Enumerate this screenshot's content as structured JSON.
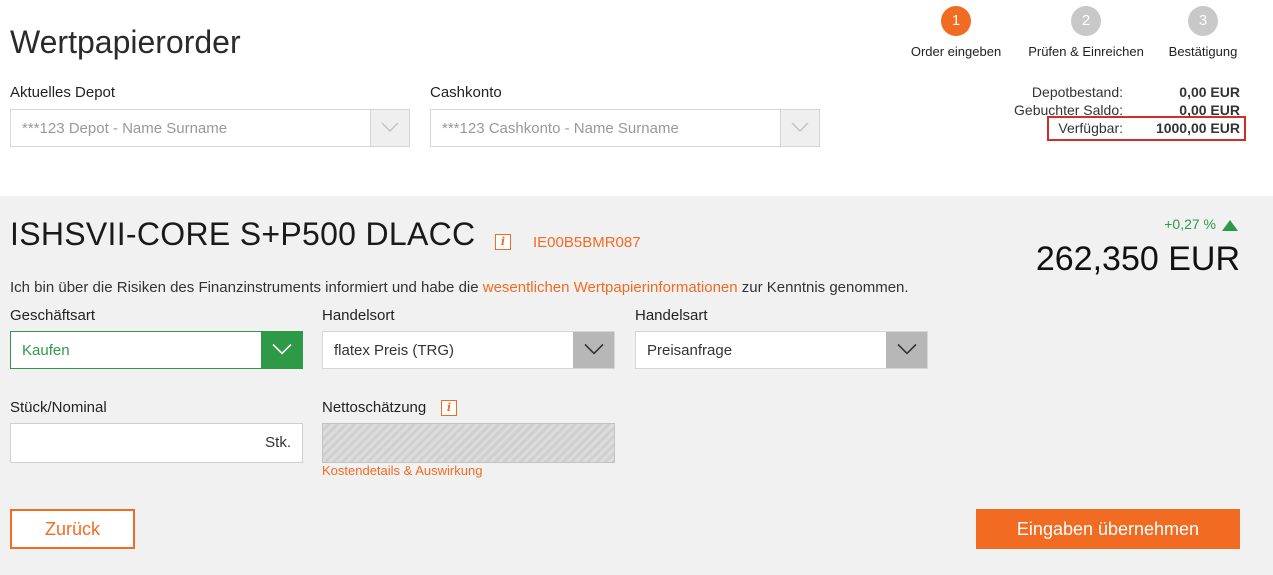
{
  "header": {
    "title": "Wertpapierorder"
  },
  "steps": [
    {
      "number": "1",
      "label": "Order eingeben"
    },
    {
      "number": "2",
      "label": "Prüfen & Einreichen"
    },
    {
      "number": "3",
      "label": "Bestätigung"
    }
  ],
  "depot": {
    "label": "Aktuelles Depot",
    "placeholder": "***123 Depot - Name Surname"
  },
  "cashkonto": {
    "label": "Cashkonto",
    "placeholder": "***123 Cashkonto - Name Surname"
  },
  "balances": [
    {
      "label": "Depotbestand:",
      "value": "0,00 EUR"
    },
    {
      "label": "Gebuchter Saldo:",
      "value": "0,00 EUR"
    },
    {
      "label": "Verfügbar:",
      "value": "1000,00 EUR"
    }
  ],
  "instrument": {
    "name": "ISHSVII-CORE S+P500 DLACC",
    "info_icon": "i",
    "isin": "IE00B5BMR087",
    "change": "+0,27 %",
    "price": "262,350 EUR"
  },
  "disclaimer": {
    "before": "Ich bin über die Risiken des Finanzinstruments informiert und habe die ",
    "link": "wesentlichen Wertpapierinformationen",
    "after": " zur Kenntnis genommen."
  },
  "form": {
    "geschaeftsart": {
      "label": "Geschäftsart",
      "value": "Kaufen"
    },
    "handelsort": {
      "label": "Handelsort",
      "value": "flatex Preis (TRG)"
    },
    "handelsart": {
      "label": "Handelsart",
      "value": "Preisanfrage"
    },
    "stueck": {
      "label": "Stück/Nominal",
      "unit": "Stk."
    },
    "netto": {
      "label": "Nettoschätzung",
      "info_icon": "i",
      "cost_link": "Kostendetails & Auswirkung"
    }
  },
  "buttons": {
    "back": "Zurück",
    "submit": "Eingaben übernehmen"
  },
  "colors": {
    "accent": "#f26b22",
    "positive": "#2e9a47",
    "highlight": "#d62b2b",
    "panel": "#f1f1f1"
  },
  "icons": {
    "dropdown": "chevron-down-icon",
    "info": "info-icon",
    "trend": "triangle-up-icon"
  }
}
